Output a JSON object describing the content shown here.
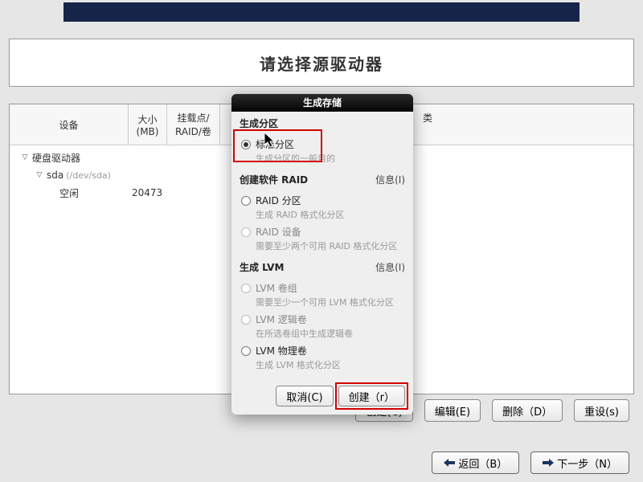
{
  "page_title": "请选择源驱动器",
  "columns": {
    "device": "设备",
    "size": "大小 (MB)",
    "mount": "挂载点/\nRAID/卷",
    "type": "类"
  },
  "tree": {
    "root_label": "硬盘驱动器",
    "disk_label": "sda",
    "disk_path": "(/dev/sda)",
    "free_label": "空闲",
    "free_size": "20473"
  },
  "table_buttons": {
    "create": "创建(C)",
    "edit": "编辑(E)",
    "delete": "删除（D）",
    "reset": "重设(s)"
  },
  "nav_buttons": {
    "back": "返回（B）",
    "next": "下一步（N）"
  },
  "dialog": {
    "title": "生成存储",
    "sec_partition": "生成分区",
    "opt_standard": "标准分区",
    "opt_standard_sub": "生成分区的一般目的",
    "sec_raid": "创建软件 RAID",
    "info": "信息(I)",
    "opt_raid_part": "RAID 分区",
    "opt_raid_part_sub": "生成 RAID 格式化分区",
    "opt_raid_dev": "RAID 设备",
    "opt_raid_dev_sub": "需要至少两个可用 RAID 格式化分区",
    "sec_lvm": "生成 LVM",
    "opt_lvm_vg": "LVM 卷组",
    "opt_lvm_vg_sub": "需要至少一个可用 LVM 格式化分区",
    "opt_lvm_lv": "LVM 逻辑卷",
    "opt_lvm_lv_sub": "在所选卷组中生成逻辑卷",
    "opt_lvm_pv": "LVM 物理卷",
    "opt_lvm_pv_sub": "生成 LVM 格式化分区",
    "cancel": "取消(C)",
    "create": "创建（r）"
  }
}
